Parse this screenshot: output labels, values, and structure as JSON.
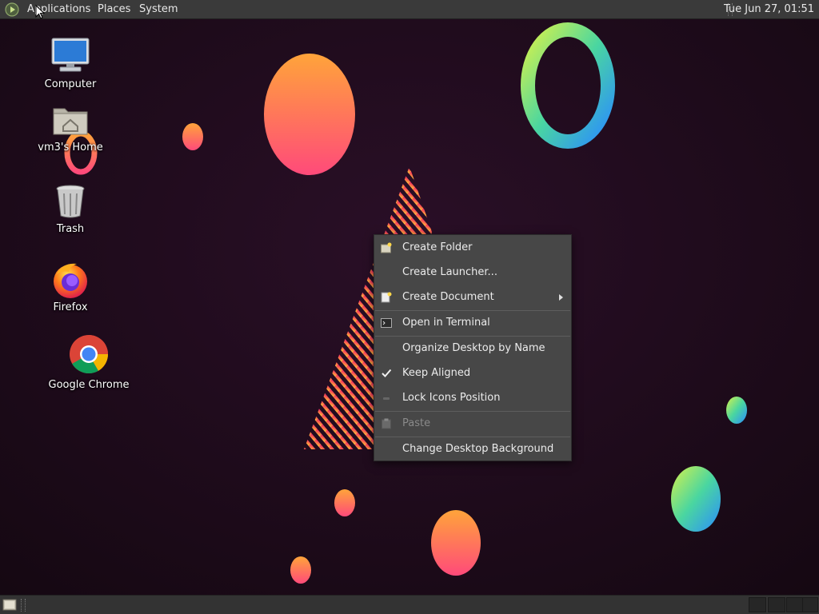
{
  "top_panel": {
    "menus": [
      "Applications",
      "Places",
      "System"
    ],
    "clock": "Tue Jun 27, 01:51"
  },
  "desktop_icons": [
    {
      "label": "Computer",
      "icon": "computer-icon"
    },
    {
      "label": "vm3's Home",
      "icon": "home-folder-icon"
    },
    {
      "label": "Trash",
      "icon": "trash-icon"
    },
    {
      "label": "Firefox",
      "icon": "firefox-icon"
    },
    {
      "label": "Google Chrome",
      "icon": "chrome-icon"
    }
  ],
  "context_menu": {
    "items": [
      {
        "label": "Create Folder",
        "icon": "new-folder-icon"
      },
      {
        "label": "Create Launcher..."
      },
      {
        "label": "Create Document",
        "icon": "new-document-icon",
        "submenu": true
      },
      {
        "label": "Open in Terminal",
        "icon": "terminal-icon"
      },
      {
        "label": "Organize Desktop by Name"
      },
      {
        "label": "Keep Aligned",
        "checked": true
      },
      {
        "label": "Lock Icons Position",
        "icon": "lock-icon"
      },
      {
        "label": "Paste",
        "icon": "paste-icon",
        "disabled": true
      },
      {
        "label": "Change Desktop Background"
      }
    ]
  },
  "colors": {
    "panel": "#3a3a3a",
    "menu_bg": "#474747",
    "wallpaper_bg": "#1f0b1e"
  }
}
